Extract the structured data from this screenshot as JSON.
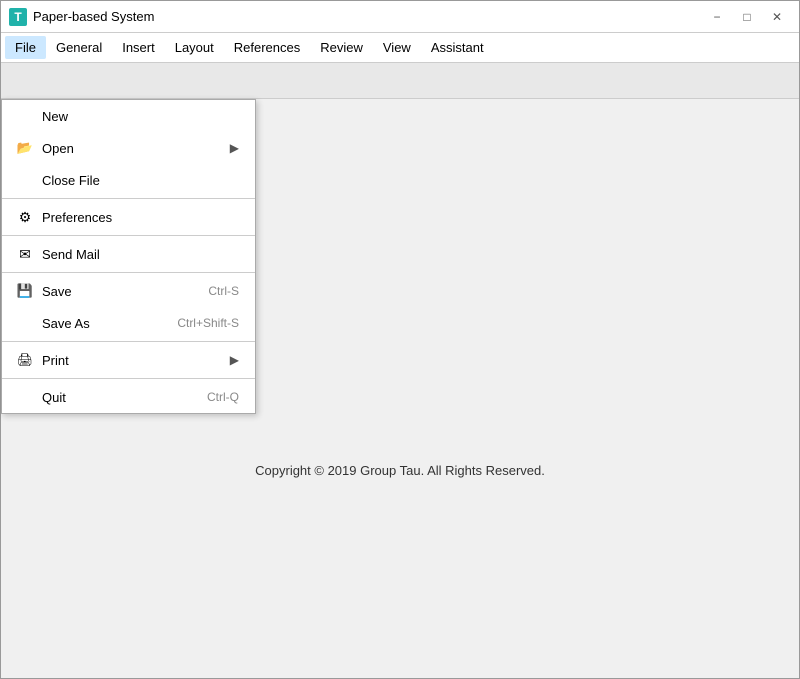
{
  "window": {
    "title": "Paper-based System",
    "icon_label": "T",
    "controls": {
      "minimize": "−",
      "maximize": "□",
      "close": "✕"
    }
  },
  "menubar": {
    "items": [
      {
        "id": "file",
        "label": "File",
        "active": true
      },
      {
        "id": "general",
        "label": "General"
      },
      {
        "id": "insert",
        "label": "Insert"
      },
      {
        "id": "layout",
        "label": "Layout"
      },
      {
        "id": "references",
        "label": "References"
      },
      {
        "id": "review",
        "label": "Review"
      },
      {
        "id": "view",
        "label": "View"
      },
      {
        "id": "assistant",
        "label": "Assistant"
      }
    ]
  },
  "dropdown": {
    "items": [
      {
        "id": "new",
        "icon": "",
        "label": "New",
        "shortcut": "",
        "has_arrow": false
      },
      {
        "id": "open",
        "icon": "open",
        "label": "Open",
        "shortcut": "",
        "has_arrow": true
      },
      {
        "id": "close-file",
        "icon": "",
        "label": "Close File",
        "shortcut": "",
        "has_arrow": false
      },
      {
        "id": "sep1",
        "type": "separator"
      },
      {
        "id": "preferences",
        "icon": "gear",
        "label": "Preferences",
        "shortcut": "",
        "has_arrow": false
      },
      {
        "id": "sep2",
        "type": "separator"
      },
      {
        "id": "send-mail",
        "icon": "mail",
        "label": "Send Mail",
        "shortcut": "",
        "has_arrow": false
      },
      {
        "id": "sep3",
        "type": "separator"
      },
      {
        "id": "save",
        "icon": "save",
        "label": "Save",
        "shortcut": "Ctrl-S",
        "has_arrow": false
      },
      {
        "id": "save-as",
        "icon": "",
        "label": "Save As",
        "shortcut": "Ctrl+Shift-S",
        "has_arrow": false
      },
      {
        "id": "sep4",
        "type": "separator"
      },
      {
        "id": "print",
        "icon": "print",
        "label": "Print",
        "shortcut": "",
        "has_arrow": true
      },
      {
        "id": "sep5",
        "type": "separator"
      },
      {
        "id": "quit",
        "icon": "",
        "label": "Quit",
        "shortcut": "Ctrl-Q",
        "has_arrow": false
      }
    ]
  },
  "footer": {
    "copyright": "Copyright © 2019 Group Tau. All Rights Reserved."
  }
}
